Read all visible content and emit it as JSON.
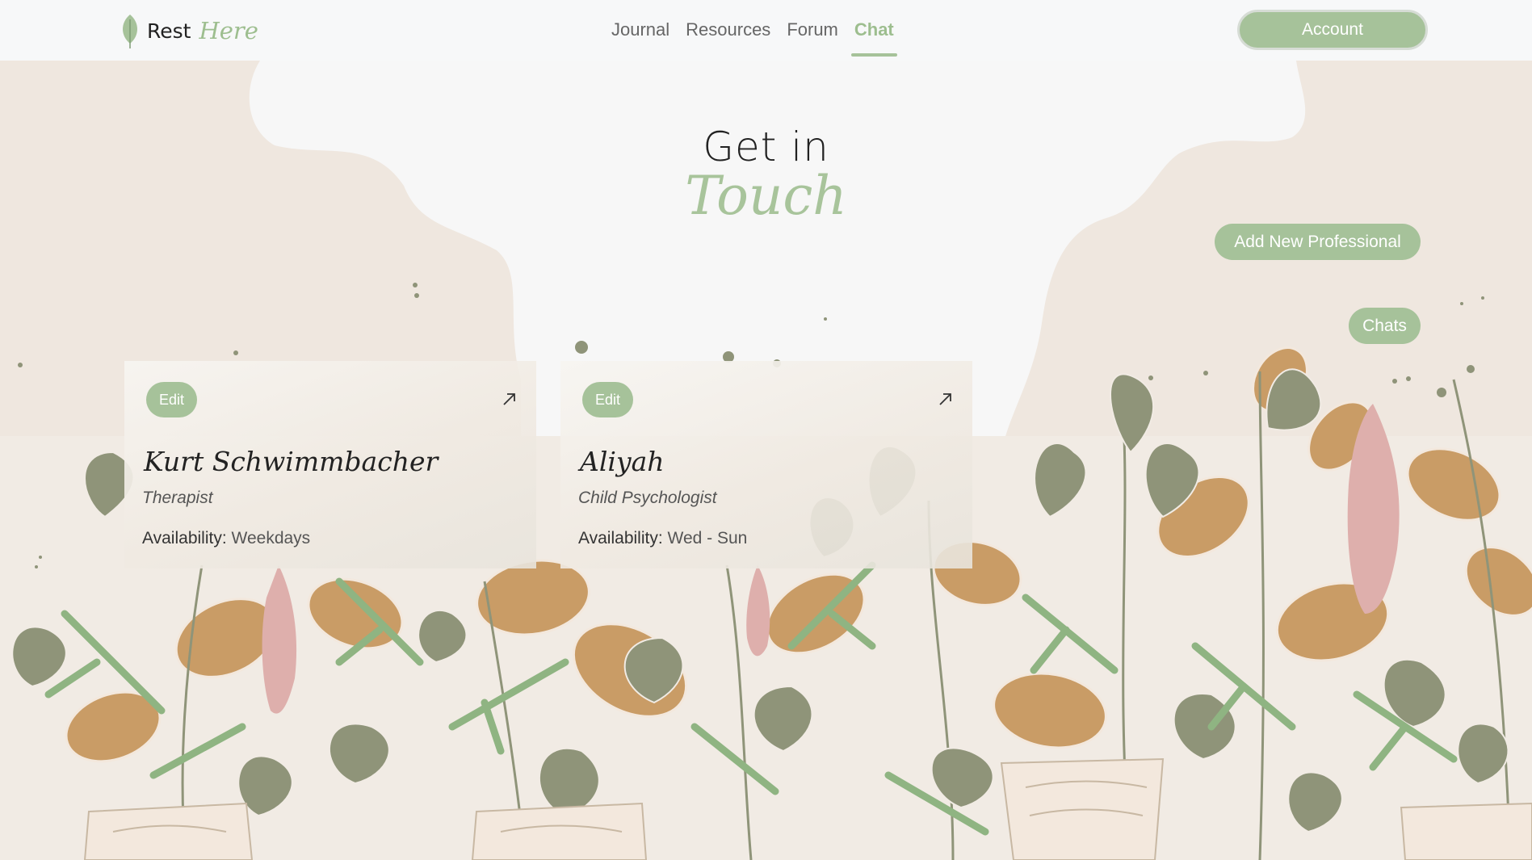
{
  "brand": {
    "name_part1": "Rest",
    "name_part2": "Here",
    "logo_icon": "leaf-icon"
  },
  "nav": {
    "links": [
      {
        "label": "Journal",
        "active": false
      },
      {
        "label": "Resources",
        "active": false
      },
      {
        "label": "Forum",
        "active": false
      },
      {
        "label": "Chat",
        "active": true
      }
    ],
    "account_label": "Account"
  },
  "hero": {
    "line1": "Get in",
    "line2": "Touch"
  },
  "actions": {
    "add_professional_label": "Add New Professional",
    "chats_label": "Chats"
  },
  "professionals": [
    {
      "edit_label": "Edit",
      "name": "Kurt Schwimmbacher",
      "role": "Therapist",
      "availability_label": "Availability:",
      "availability_value": "Weekdays",
      "open_icon": "arrow-up-right-icon"
    },
    {
      "edit_label": "Edit",
      "name": "Aliyah",
      "role": "Child Psychologist",
      "availability_label": "Availability:",
      "availability_value": "Wed - Sun",
      "open_icon": "arrow-up-right-icon"
    }
  ],
  "colors": {
    "accent_green": "#a6c29a",
    "page_bg": "#f7f7f7",
    "blob_beige": "#efe7df",
    "leaf_olive": "#8f9479",
    "leaf_orange": "#c99c66",
    "leaf_green": "#8fb482",
    "bloom_pink": "#deafac",
    "pot_cream": "#f3e8dd"
  }
}
